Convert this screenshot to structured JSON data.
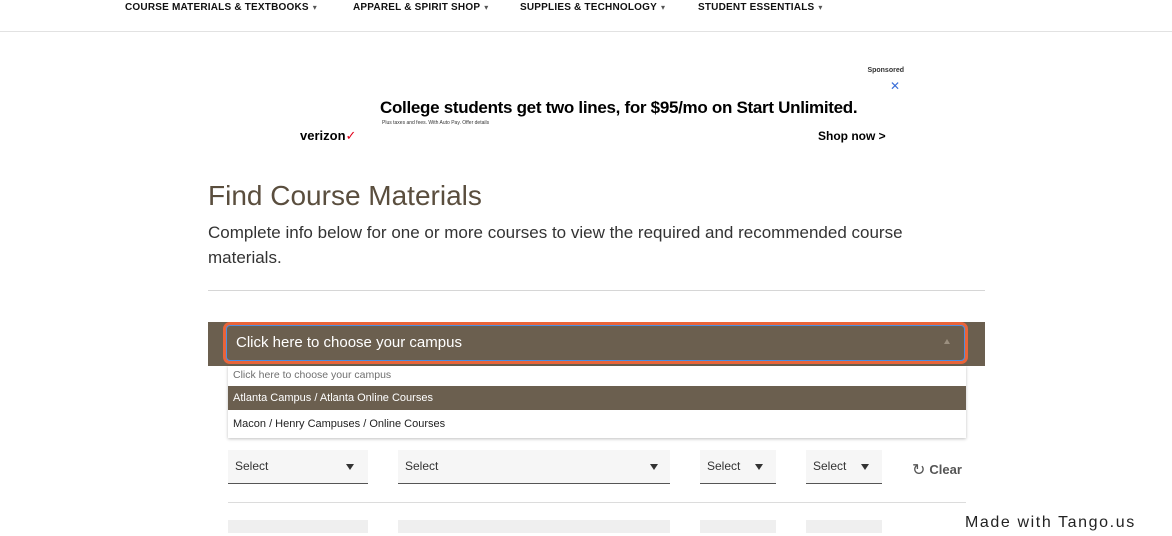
{
  "nav": {
    "items": [
      {
        "label": "COURSE MATERIALS & TEXTBOOKS"
      },
      {
        "label": "APPAREL & SPIRIT SHOP"
      },
      {
        "label": "SUPPLIES & TECHNOLOGY"
      },
      {
        "label": "STUDENT ESSENTIALS"
      }
    ],
    "caret": "▾"
  },
  "ad": {
    "sponsored": "Sponsored",
    "close": "✕",
    "headline": "College students get two lines, for $95/mo on Start Unlimited.",
    "fine_print": "Plus taxes and fees. With Auto Pay. Offer details",
    "brand": "verizon",
    "brand_mark": "✓",
    "cta": "Shop now  >"
  },
  "page": {
    "title": "Find Course Materials",
    "description": "Complete info below for one or more courses to view the required and recommended course materials."
  },
  "campus": {
    "selected": "Click here to choose your campus",
    "options": [
      {
        "label": "Click here to choose your campus"
      },
      {
        "label": "Atlanta Campus / Atlanta Online Courses"
      },
      {
        "label": "Macon / Henry Campuses / Online Courses"
      }
    ],
    "highlighted_index": 1
  },
  "selects": [
    {
      "label": "Select"
    },
    {
      "label": "Select"
    },
    {
      "label": "Select"
    },
    {
      "label": "Select"
    }
  ],
  "clear": {
    "icon": "↻",
    "label": "Clear"
  },
  "watermark": "Made with Tango.us",
  "colors": {
    "brand_brown": "#6b5f4f",
    "focus_ring": "#e8643a",
    "title": "#5a4e3e"
  }
}
